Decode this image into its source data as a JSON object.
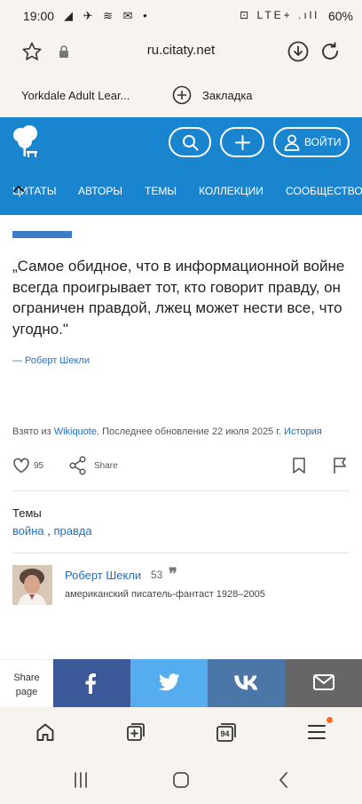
{
  "status_bar": {
    "time": "19:00",
    "left_icons": "◢ ✈ ≋ ✉ •",
    "right_icons": "⊡ LTE+ .ıll",
    "battery": "60%"
  },
  "browser": {
    "url": "ru.citaty.net"
  },
  "bookmarks": {
    "item1": "Yorkdale Adult Lear...",
    "add_label": "Закладка"
  },
  "header": {
    "login_label": "ВОЙТИ",
    "nav": [
      "ЦИТАТЫ",
      "АВТОРЫ",
      "ТЕМЫ",
      "КОЛЛЕКЦИИ",
      "СООБЩЕСТВО"
    ]
  },
  "quote": {
    "text": "„Самое обидное, что в информационной войне всегда проигрывает тот, кто говорит правду, он ограничен правдой, лжец может нести все, что угодно.\"",
    "author_line": "— Роберт Шекли"
  },
  "source": {
    "prefix": "Взято из",
    "site": "Wikiquote",
    "updated": ". Последнее обновление 22 июля 2025 г.",
    "history": "История"
  },
  "actions": {
    "likes": "95",
    "share_label": "Share"
  },
  "themes": {
    "label": "Темы",
    "tag1": "война",
    "separator": " , ",
    "tag2": "правда"
  },
  "author": {
    "name": "Роберт Шекли",
    "count": "53",
    "description": "американский писатель-фантаст 1928–2005"
  },
  "share_bar": {
    "label_line1": "Share",
    "label_line2": "page"
  },
  "bottom_toolbar": {
    "tabs_count": "94"
  },
  "colors": {
    "header_blue": "#1a85cf",
    "facebook": "#3b5998",
    "twitter": "#55acee",
    "vk": "#4a76a8",
    "email": "#666666"
  }
}
